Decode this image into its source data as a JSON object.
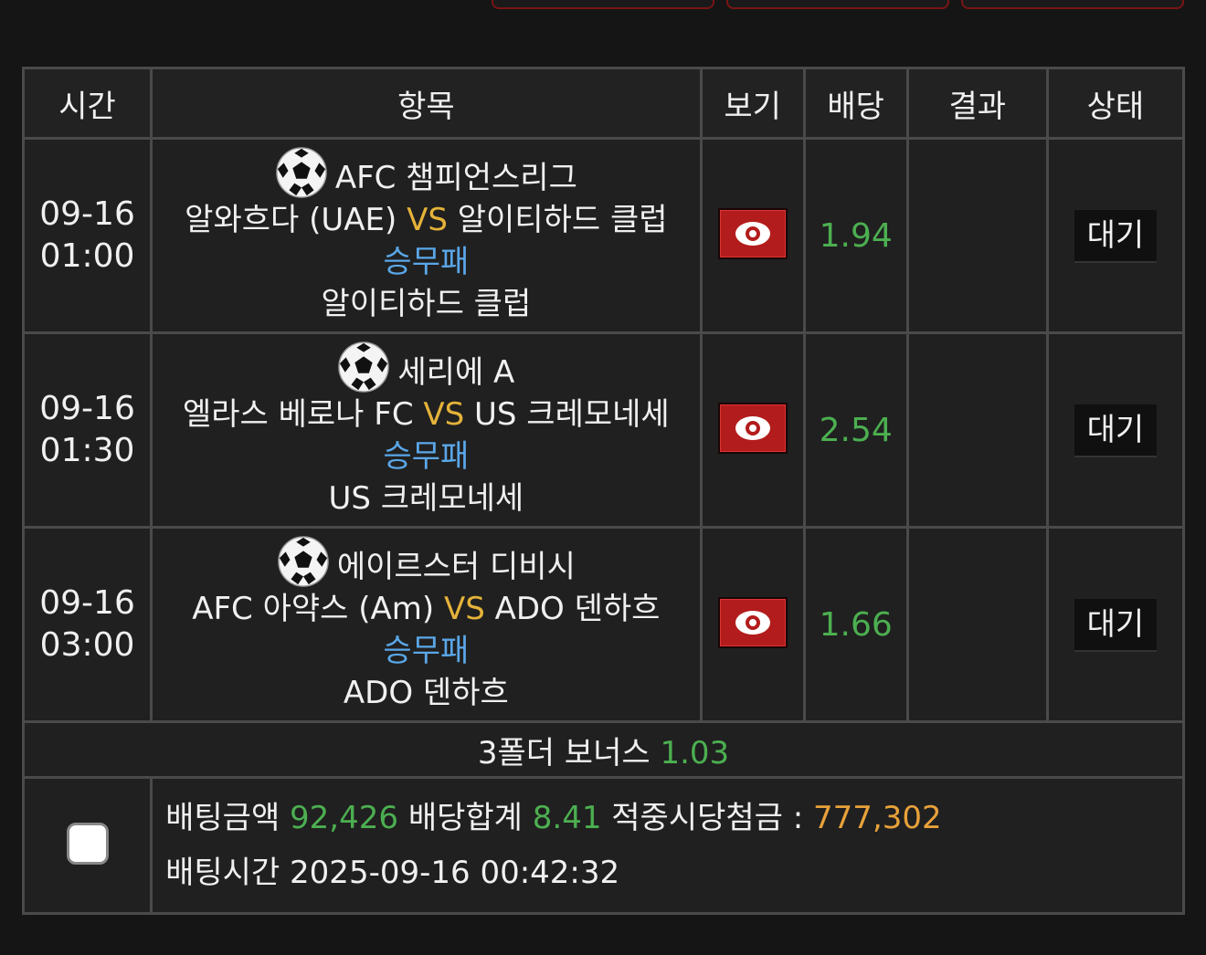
{
  "header": {
    "time": "시간",
    "item": "항목",
    "view": "보기",
    "odds": "배당",
    "result": "결과",
    "status": "상태"
  },
  "matches": [
    {
      "date": "09-16",
      "time": "01:00",
      "league": "AFC 챔피언스리그",
      "home": "알와흐다 (UAE)",
      "vs": "VS",
      "away": "알이티하드 클럽",
      "bet_type": "승무패",
      "pick": "알이티하드 클럽",
      "odds": "1.94",
      "result": "",
      "status": "대기"
    },
    {
      "date": "09-16",
      "time": "01:30",
      "league": "세리에 A",
      "home": "엘라스 베로나 FC",
      "vs": "VS",
      "away": "US 크레모네세",
      "bet_type": "승무패",
      "pick": "US 크레모네세",
      "odds": "2.54",
      "result": "",
      "status": "대기"
    },
    {
      "date": "09-16",
      "time": "03:00",
      "league": "에이르스터 디비시",
      "home": "AFC 아약스 (Am)",
      "vs": "VS",
      "away": "ADO 덴하흐",
      "bet_type": "승무패",
      "pick": "ADO 덴하흐",
      "odds": "1.66",
      "result": "",
      "status": "대기"
    }
  ],
  "bonus": {
    "label": "3폴더 보너스",
    "value": "1.03"
  },
  "summary": {
    "amount_label": "배팅금액",
    "amount": "92,426",
    "odds_total_label": "배당합계",
    "odds_total": "8.41",
    "payout_label": "적중시당첨금 :",
    "payout": "777,302",
    "time_label": "배팅시간",
    "time": "2025-09-16 00:42:32"
  },
  "icons": {
    "league": "soccer-ball-icon",
    "view": "eye-icon"
  },
  "colors": {
    "odds": "#4caf50",
    "vs": "#e5b33a",
    "bet_type": "#5aa7e8",
    "payout": "#e8a13a",
    "view_button": "#b31c1c"
  }
}
